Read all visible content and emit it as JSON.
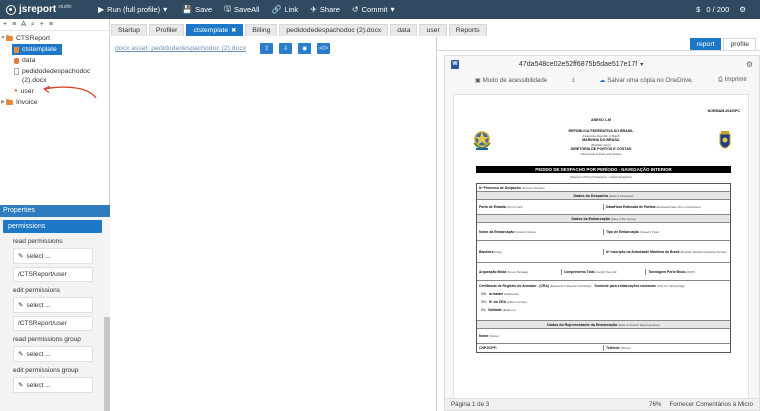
{
  "topbar": {
    "brand": "jsreport",
    "brand_suffix": "studio",
    "run_label": "Run (full profile)",
    "save_label": "Save",
    "saveall_label": "SaveAll",
    "link_label": "Link",
    "share_label": "Share",
    "commit_label": "Commit",
    "credits": "0 / 200"
  },
  "tree": {
    "toolbar": [
      "+",
      "≡",
      "A",
      "⌕",
      "+",
      "≡"
    ],
    "root": "CTSReport",
    "items": [
      {
        "label": "ctstemplate",
        "type": "template",
        "selected": true
      },
      {
        "label": "data",
        "type": "data"
      },
      {
        "label": "pedidodedespachodoc (2).docx",
        "type": "asset"
      },
      {
        "label": "user",
        "type": "user"
      }
    ],
    "folder2": "Invoice"
  },
  "properties": {
    "header": "Properties",
    "active_tab": "permissions",
    "groups": [
      {
        "label": "read permissions",
        "select": "select ...",
        "value": "/CTSReport/user"
      },
      {
        "label": "edit permissions",
        "select": "select ...",
        "value": "/CTSReport/user"
      },
      {
        "label": "read permissions group",
        "select": "select ..."
      },
      {
        "label": "edit permissions group",
        "select": "select ..."
      }
    ]
  },
  "tabs": [
    {
      "label": "Startup"
    },
    {
      "label": "Profiler"
    },
    {
      "label": "ctstemplate",
      "active": true
    },
    {
      "label": "Billing"
    },
    {
      "label": "pedidodedespachodoc (2).docx"
    },
    {
      "label": "data"
    },
    {
      "label": "user"
    },
    {
      "label": "Reports"
    }
  ],
  "editor": {
    "asset_link": "docx asset: pedidodedespachodoc (2).docx"
  },
  "preview": {
    "tabs": [
      "report",
      "profile"
    ],
    "active_tab": "report",
    "viewer": {
      "doc_title": "47da548ce02e52ff6875b5dae517e17f",
      "accessibility": "Modo de acessibilidade",
      "save_onedrive": "Salvar uma cópia no OneDrive.",
      "print": "Imprimir",
      "page": "Página 1 de 3",
      "zoom": "76%",
      "feedback": "Fornecer Comentários à Micro"
    },
    "document": {
      "norm": "NORMAM-204/DPC",
      "anexo": "ANEXO 1-M",
      "rep": "REPÚBLICA FEDERATIVA DO BRASIL",
      "rep_en": "(Federative Republic of Brazil)",
      "marinha": "MARINHA DO BRASIL",
      "marinha_en": "(Brazilian Navy)",
      "diretoria": "DIRETORIA DE PORTOS E COSTAS",
      "diretoria_en": "(Directorate of Ports and Coasts)",
      "banner": "PEDIDO DE DESPACHO POR PERÍODO - NAVEGAÇÃO INTERIOR",
      "banner_en": "(Request of Period Clearance - Inland Navigation)",
      "processo": "Nº Processo de Despacho",
      "processo_en": "(Process Number)",
      "sec1": "Dados do Despacho",
      "sec1_en": "(Data of Clearance)",
      "porto": "Porto de Estadia",
      "porto_en": "(Port of Call)",
      "datahora": "Data/Hora Estimada de Partida",
      "datahora_en": "(Estimated Date-Time of Departure)",
      "sec2": "Dados da Embarcação",
      "sec2_en": "(Data of the Vessel)",
      "nome": "Nome da Embarcação",
      "nome_en": "(Vessel's Name)",
      "tipo": "Tipo de Embarcação",
      "tipo_en": "(Vessel's Type)",
      "bandeira": "Bandeira",
      "bandeira_en": "(Flag)",
      "inscricao": "Nº Inscrição na Autoridade Marítima do Brasil",
      "inscricao_en": "(Brazilian Maritime Authority Number)",
      "arqueacao": "Arqueação Bruta",
      "arqueacao_en": "(Gross Tonnage)",
      "comprimento": "Comprimento Total",
      "comprimento_en": "(Length Over All)",
      "tonelagem": "Tonelagem Porte Bruto",
      "tonelagem_en": "(DWT)",
      "certificado": "Certificado de Registro do Armador - (CRA)",
      "certificado_en": "(Shipowner's Register Certificate)",
      "somente": "Somente para embarcações nacionais",
      "somente_en": "(Only for national flag)",
      "xiii": "XIII.",
      "armador": "Armador",
      "armador_en": "(Shipowner)",
      "xiv": "XIV.",
      "ncra": "Nº do CRA",
      "ncra_en": "(CRA's number)",
      "xv": "XV.",
      "validade": "Validade",
      "validade_en": "(Expire in)",
      "sec3": "Dados do Representante da Embarcação",
      "sec3_en": "(Data of Vessel's Representative)",
      "rep_nome": "Nome",
      "rep_nome_en": "(Name)",
      "cnpj": "CNPJ/CPF:",
      "telefone": "Telefone",
      "telefone_en": "(Phone)"
    }
  }
}
